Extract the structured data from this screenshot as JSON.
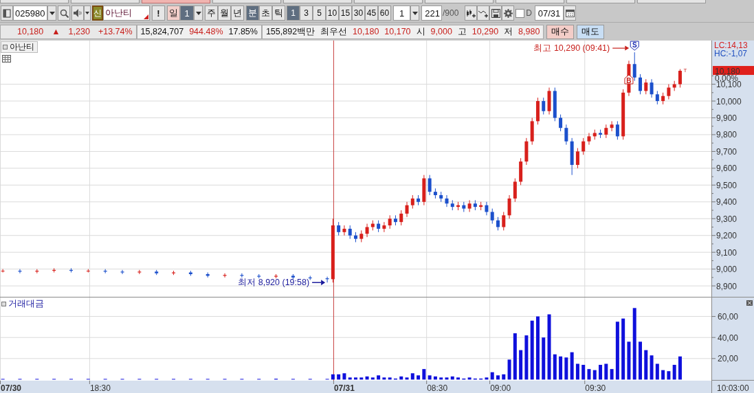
{
  "top_tabs": [
    {
      "selected": false
    },
    {
      "selected": false
    },
    {
      "selected": true
    },
    {
      "selected": false
    },
    {
      "selected": false
    },
    {
      "selected": false
    },
    {
      "selected": false
    },
    {
      "selected": false
    },
    {
      "selected": false
    },
    {
      "selected": false
    }
  ],
  "toolbar": {
    "code": "025980",
    "stock_badge": "신",
    "stock_name": "아난티",
    "alert_button": "!",
    "day_button": {
      "label": "일",
      "count": "1"
    },
    "periods": [
      {
        "label": "주",
        "selected": false
      },
      {
        "label": "월",
        "selected": false
      },
      {
        "label": "년",
        "selected": false
      },
      {
        "label": "분",
        "selected": true
      },
      {
        "label": "초",
        "selected": false
      },
      {
        "label": "틱",
        "selected": false
      }
    ],
    "intervals": [
      {
        "label": "1",
        "selected": true
      },
      {
        "label": "3",
        "selected": false
      },
      {
        "label": "5",
        "selected": false
      },
      {
        "label": "10",
        "selected": false
      },
      {
        "label": "15",
        "selected": false
      },
      {
        "label": "30",
        "selected": false
      },
      {
        "label": "45",
        "selected": false
      },
      {
        "label": "60",
        "selected": false
      }
    ],
    "multiplier": "1",
    "count": "221",
    "count_max": "/900",
    "date_checked": false,
    "date_label": "D",
    "date": "07/31"
  },
  "info_bar": {
    "groups": [
      [
        {
          "text": "10,180",
          "kind": "up"
        },
        {
          "text": "▲",
          "kind": "up"
        },
        {
          "text": "1,230",
          "kind": "up"
        },
        {
          "text": "+13.74%",
          "kind": "up"
        }
      ],
      [
        {
          "text": "15,824,707",
          "kind": "plain"
        },
        {
          "text": "944.48%",
          "kind": "up"
        },
        {
          "text": "17.85%",
          "kind": "plain"
        }
      ],
      [
        {
          "text": "155,892백만",
          "kind": "plain"
        },
        {
          "text": "최우선",
          "kind": "plain"
        },
        {
          "text": "10,180",
          "kind": "up"
        },
        {
          "text": "10,170",
          "kind": "up"
        },
        {
          "text": "시",
          "kind": "plain"
        },
        {
          "text": "9,000",
          "kind": "up"
        },
        {
          "text": "고",
          "kind": "plain"
        },
        {
          "text": "10,290",
          "kind": "up"
        },
        {
          "text": "저",
          "kind": "plain"
        },
        {
          "text": "8,980",
          "kind": "up"
        }
      ]
    ],
    "buttons": [
      {
        "label": "매수",
        "kind": "buy"
      },
      {
        "label": "매도",
        "kind": "sell"
      }
    ]
  },
  "price_panel": {
    "label": "아난티",
    "axis_info": [
      {
        "text": "LC:14,13",
        "color": "#d42020"
      },
      {
        "text": "HC:-1,07",
        "color": "#2050c0"
      }
    ],
    "price_tag": {
      "text": "10,180",
      "change": "0,00%"
    },
    "notes": [
      {
        "kind": "low",
        "text": "최저 8,920 (19:58)"
      },
      {
        "kind": "high",
        "text": "최고 10,290 (09:41)"
      },
      {
        "kind": "sell_marker",
        "text": "S"
      },
      {
        "kind": "buy_marker",
        "text": "B"
      },
      {
        "kind": "tag",
        "text": "T"
      }
    ],
    "chart_data": {
      "type": "candlestick",
      "grid": true,
      "ylim": [
        8835,
        10360
      ],
      "categories": [
        null,
        null,
        null,
        null,
        null,
        null,
        null,
        null,
        null,
        null,
        null,
        null,
        null,
        null,
        null,
        null,
        null,
        null,
        null,
        null,
        null,
        null,
        null,
        null,
        null,
        null,
        null,
        null,
        null,
        null,
        null,
        null,
        null,
        null,
        null,
        null,
        null,
        null,
        null,
        null,
        null,
        null,
        null,
        null,
        null,
        null,
        null,
        null,
        null,
        null,
        null,
        null,
        null,
        null,
        null,
        null,
        null,
        null,
        null,
        null,
        null,
        null,
        null,
        null,
        null,
        null,
        null,
        null,
        null,
        null,
        null,
        null,
        null,
        null,
        null,
        null,
        null,
        null,
        null,
        null,
        null,
        null,
        null,
        null,
        null,
        null,
        null,
        null,
        null,
        null,
        null,
        null,
        null,
        null,
        null,
        null,
        null,
        null,
        null,
        null,
        null,
        null,
        null,
        null,
        null,
        null,
        null,
        null,
        null,
        null,
        null,
        null,
        null,
        null,
        null,
        null,
        null,
        null,
        null,
        null,
        null,
        null,
        null,
        null,
        null
      ],
      "yticks": [
        {
          "value": 8900,
          "label": "8,900"
        },
        {
          "value": 9000,
          "label": "9,000"
        },
        {
          "value": 9100,
          "label": "9,100"
        },
        {
          "value": 9200,
          "label": "9,200"
        },
        {
          "value": 9300,
          "label": "9,300"
        },
        {
          "value": 9400,
          "label": "9,400"
        },
        {
          "value": 9500,
          "label": "9,500"
        },
        {
          "value": 9600,
          "label": "9,600"
        },
        {
          "value": 9700,
          "label": "9,700"
        },
        {
          "value": 9800,
          "label": "9,800"
        },
        {
          "value": 9900,
          "label": "9,900"
        },
        {
          "value": 10000,
          "label": "10,000"
        },
        {
          "value": 10100,
          "label": "10,100"
        }
      ],
      "ohlc": [
        [
          8990,
          9000,
          8980,
          8990
        ],
        null,
        null,
        [
          8990,
          9000,
          8975,
          8985
        ],
        null,
        null,
        [
          8985,
          9000,
          8975,
          8990
        ],
        null,
        null,
        [
          8990,
          9005,
          8980,
          8995
        ],
        null,
        null,
        [
          8995,
          9005,
          8980,
          8990
        ],
        null,
        null,
        [
          8990,
          9000,
          8980,
          8990
        ],
        null,
        null,
        [
          8990,
          9000,
          8975,
          8985
        ],
        null,
        null,
        [
          8985,
          8995,
          8970,
          8980
        ],
        null,
        null,
        [
          8980,
          8995,
          8970,
          8985
        ],
        null,
        null,
        [
          8985,
          8995,
          8965,
          8975
        ],
        null,
        null,
        [
          8975,
          8990,
          8965,
          8980
        ],
        null,
        null,
        [
          8980,
          8990,
          8960,
          8970
        ],
        null,
        null,
        [
          8970,
          8980,
          8950,
          8960
        ],
        null,
        null,
        [
          8960,
          8975,
          8950,
          8965
        ],
        null,
        null,
        [
          8965,
          8975,
          8950,
          8960
        ],
        null,
        null,
        [
          8960,
          8970,
          8945,
          8955
        ],
        null,
        null,
        [
          8955,
          8970,
          8945,
          8960
        ],
        null,
        null,
        [
          8960,
          8970,
          8940,
          8950
        ],
        null,
        null,
        [
          8950,
          8960,
          8935,
          8945
        ],
        null,
        null,
        [
          8945,
          8955,
          8920,
          8940
        ],
        [
          8940,
          9300,
          8920,
          9260
        ],
        [
          9260,
          9280,
          9200,
          9220
        ],
        [
          9220,
          9260,
          9200,
          9240
        ],
        [
          9240,
          9260,
          9180,
          9200
        ],
        [
          9200,
          9220,
          9160,
          9180
        ],
        [
          9180,
          9230,
          9160,
          9210
        ],
        [
          9210,
          9270,
          9190,
          9250
        ],
        [
          9250,
          9290,
          9230,
          9270
        ],
        [
          9270,
          9290,
          9220,
          9240
        ],
        [
          9240,
          9280,
          9220,
          9260
        ],
        [
          9260,
          9320,
          9240,
          9300
        ],
        [
          9300,
          9320,
          9260,
          9280
        ],
        [
          9280,
          9350,
          9260,
          9330
        ],
        [
          9330,
          9400,
          9310,
          9380
        ],
        [
          9380,
          9440,
          9360,
          9420
        ],
        [
          9420,
          9440,
          9380,
          9400
        ],
        [
          9400,
          9560,
          9380,
          9540
        ],
        [
          9540,
          9560,
          9440,
          9460
        ],
        [
          9460,
          9480,
          9420,
          9440
        ],
        [
          9440,
          9460,
          9400,
          9420
        ],
        [
          9420,
          9440,
          9370,
          9390
        ],
        [
          9390,
          9410,
          9350,
          9370
        ],
        [
          9370,
          9400,
          9350,
          9380
        ],
        [
          9380,
          9400,
          9340,
          9360
        ],
        [
          9360,
          9410,
          9340,
          9390
        ],
        [
          9390,
          9410,
          9350,
          9370
        ],
        [
          9370,
          9400,
          9350,
          9380
        ],
        [
          9380,
          9400,
          9320,
          9340
        ],
        [
          9340,
          9360,
          9270,
          9290
        ],
        [
          9290,
          9310,
          9230,
          9250
        ],
        [
          9250,
          9340,
          9230,
          9320
        ],
        [
          9320,
          9440,
          9300,
          9420
        ],
        [
          9420,
          9540,
          9400,
          9520
        ],
        [
          9520,
          9660,
          9500,
          9640
        ],
        [
          9640,
          9780,
          9620,
          9760
        ],
        [
          9760,
          9900,
          9740,
          9880
        ],
        [
          9880,
          10020,
          9860,
          10000
        ],
        [
          10000,
          10020,
          9920,
          9940
        ],
        [
          9940,
          10080,
          9920,
          10060
        ],
        [
          10060,
          10080,
          9880,
          9900
        ],
        [
          9900,
          9920,
          9820,
          9840
        ],
        [
          9840,
          9860,
          9740,
          9760
        ],
        [
          9760,
          9780,
          9560,
          9620
        ],
        [
          9620,
          9720,
          9600,
          9700
        ],
        [
          9700,
          9780,
          9680,
          9760
        ],
        [
          9760,
          9810,
          9740,
          9790
        ],
        [
          9790,
          9830,
          9770,
          9810
        ],
        [
          9810,
          9830,
          9780,
          9800
        ],
        [
          9800,
          9860,
          9780,
          9840
        ],
        [
          9840,
          9880,
          9820,
          9860
        ],
        [
          9860,
          9880,
          9770,
          9790
        ],
        [
          9790,
          10070,
          9770,
          10050
        ],
        [
          10050,
          10240,
          10030,
          10220
        ],
        [
          10220,
          10290,
          10120,
          10140
        ],
        [
          10140,
          10160,
          10040,
          10060
        ],
        [
          10060,
          10130,
          10040,
          10110
        ],
        [
          10110,
          10130,
          10020,
          10040
        ],
        [
          10040,
          10060,
          9980,
          10000
        ],
        [
          10000,
          10050,
          9980,
          10030
        ],
        [
          10030,
          10100,
          10010,
          10080
        ],
        [
          10080,
          10120,
          10060,
          10100
        ],
        [
          10100,
          10190,
          10080,
          10180
        ],
        null,
        null,
        null,
        null,
        null
      ]
    }
  },
  "volume_panel": {
    "label": "거래대금",
    "chart_data": {
      "type": "bar",
      "grid": true,
      "ylim": [
        -1,
        78
      ],
      "categories": [
        null,
        null,
        null,
        null,
        null,
        null,
        null,
        null,
        null,
        null,
        null,
        null,
        null,
        null,
        null,
        null,
        null,
        null,
        null,
        null,
        null,
        null,
        null,
        null,
        null,
        null,
        null,
        null,
        null,
        null,
        null,
        null,
        null,
        null,
        null,
        null,
        null,
        null,
        null,
        null,
        null,
        null,
        null,
        null,
        null,
        null,
        null,
        null,
        null,
        null,
        null,
        null,
        null,
        null,
        null,
        null,
        null,
        null,
        null,
        null,
        null,
        null,
        null,
        null,
        null,
        null,
        null,
        null,
        null,
        null,
        null,
        null,
        null,
        null,
        null,
        null,
        null,
        null,
        null,
        null,
        null,
        null,
        null,
        null,
        null,
        null,
        null,
        null,
        null,
        null,
        null,
        null,
        null,
        null,
        null,
        null,
        null,
        null,
        null,
        null,
        null,
        null,
        null,
        null,
        null,
        null,
        null,
        null,
        null,
        null,
        null,
        null,
        null,
        null,
        null,
        null,
        null,
        null,
        null,
        null,
        null,
        null,
        null,
        null,
        null
      ],
      "yticks": [
        {
          "value": 20,
          "label": "20,00"
        },
        {
          "value": 40,
          "label": "40,00"
        },
        {
          "value": 60,
          "label": "60,00"
        }
      ],
      "values": [
        0.3,
        null,
        null,
        0.3,
        null,
        null,
        0.2,
        null,
        null,
        0.3,
        null,
        null,
        0.2,
        null,
        null,
        0.2,
        null,
        null,
        0.3,
        null,
        null,
        0.2,
        null,
        null,
        0.2,
        null,
        null,
        0.3,
        null,
        null,
        0.2,
        null,
        null,
        0.2,
        null,
        null,
        0.2,
        null,
        null,
        0.2,
        null,
        null,
        0.3,
        null,
        null,
        0.2,
        null,
        null,
        0.8,
        null,
        null,
        0.2,
        null,
        null,
        0.6,
        null,
        null,
        0.3,
        5,
        5,
        6,
        2,
        2,
        2,
        3,
        2,
        4,
        2,
        2,
        1,
        3,
        2,
        6,
        4,
        10,
        4,
        3,
        2,
        2,
        3,
        2,
        1,
        2,
        1,
        1,
        2,
        7,
        4,
        5,
        19,
        44,
        28,
        42,
        56,
        60,
        40,
        62,
        24,
        22,
        21,
        26,
        15,
        14,
        10,
        9,
        14,
        15,
        10,
        55,
        58,
        36,
        68,
        36,
        28,
        23,
        15,
        9,
        8,
        14,
        22,
        null,
        null,
        null,
        null,
        null
      ]
    }
  },
  "time_axis": {
    "labels": [
      {
        "text": "07/30",
        "kind": "date"
      },
      {
        "text": "18:30",
        "kind": "time"
      },
      {
        "text": "07/31",
        "kind": "date"
      },
      {
        "text": "08:30",
        "kind": "time"
      },
      {
        "text": "09:00",
        "kind": "time"
      },
      {
        "text": "09:30",
        "kind": "time"
      }
    ],
    "current_time": "10:03:00"
  }
}
